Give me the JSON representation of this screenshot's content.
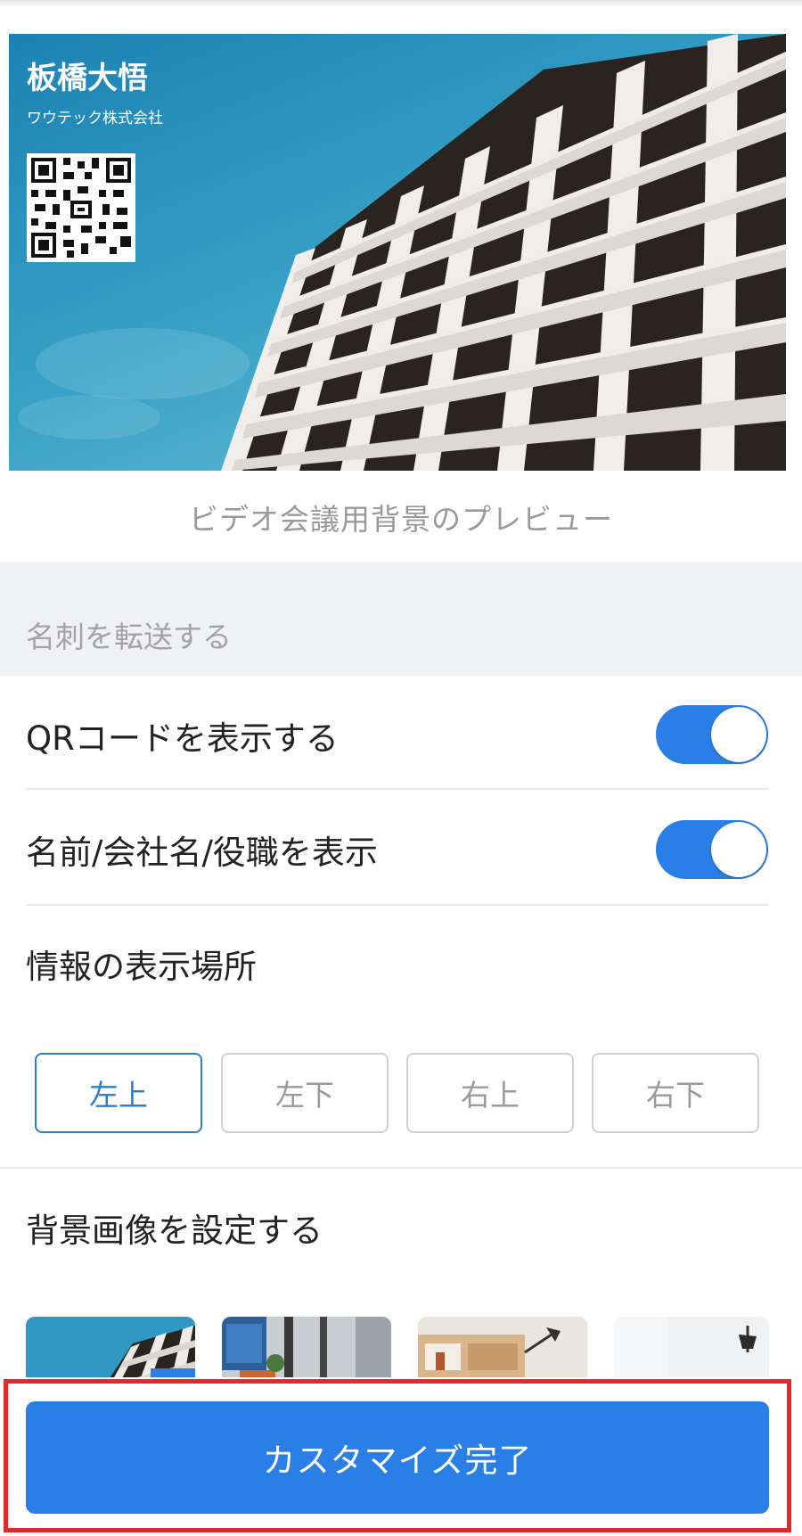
{
  "preview": {
    "card_name": "板橋大悟",
    "card_company": "ワウテック株式会社",
    "caption": "ビデオ会議用背景のプレビュー"
  },
  "section": {
    "title": "名刺を転送する"
  },
  "settings": {
    "show_qr": {
      "label": "QRコードを表示する",
      "enabled": true
    },
    "show_info": {
      "label": "名前/会社名/役職を表示",
      "enabled": true
    },
    "position": {
      "label": "情報の表示場所",
      "options": [
        "左上",
        "左下",
        "右上",
        "右下"
      ],
      "selected": "左上"
    },
    "background": {
      "label": "背景画像を設定する",
      "thumbnails": [
        "building-background",
        "office-background",
        "shelf-background",
        "lamp-background"
      ]
    }
  },
  "footer": {
    "done_label": "カスタマイズ完了"
  },
  "colors": {
    "accent": "#2a7fe6",
    "highlight": "#e22a2e"
  }
}
